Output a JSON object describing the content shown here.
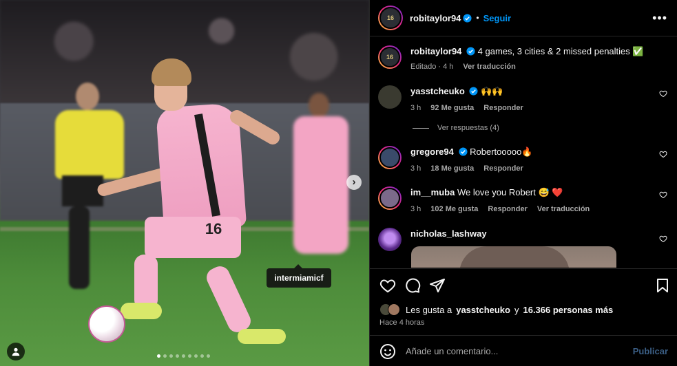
{
  "post": {
    "author": "robitaylor94",
    "follow_label": "Seguir",
    "separator": "•",
    "avatar_text": "16",
    "media": {
      "tag_label": "intermiamicf",
      "jersey_number": "16",
      "carousel_count": 9,
      "carousel_active": 1
    }
  },
  "caption": {
    "username": "robitaylor94",
    "text": "4 games, 3 cities & 2 missed penalties ✅",
    "meta_edited": "Editado · 4 h",
    "meta_translate": "Ver traducción"
  },
  "comments": [
    {
      "username": "yasstcheuko",
      "verified": true,
      "text": "🙌🙌",
      "time": "3 h",
      "likes": "92 Me gusta",
      "reply": "Responder",
      "view_replies": "Ver respuestas (4)"
    },
    {
      "username": "gregore94",
      "verified": true,
      "text": "Robertooooo🔥",
      "time": "3 h",
      "likes": "18 Me gusta",
      "reply": "Responder"
    },
    {
      "username": "im__muba",
      "verified": false,
      "text": "We love you Robert 😅 ❤️",
      "time": "3 h",
      "likes": "102 Me gusta",
      "reply": "Responder",
      "translate": "Ver traducción"
    },
    {
      "username": "nicholas_lashway",
      "verified": false,
      "text": ""
    }
  ],
  "engagement": {
    "likes_prefix": "Les gusta a",
    "likes_user": "yasstcheuko",
    "likes_middle": "y",
    "likes_count": "16.366 personas más",
    "time_ago": "Hace 4 horas"
  },
  "composer": {
    "placeholder": "Añade un comentario...",
    "publish_label": "Publicar"
  },
  "icons": {
    "more": "more-horizontal-icon",
    "like": "heart-outline-icon",
    "comment": "comment-bubble-icon",
    "share": "paper-plane-icon",
    "save": "bookmark-icon",
    "emoji": "smiley-icon",
    "verified": "verified-badge-icon",
    "next": "chevron-right-icon",
    "user_tags": "person-icon"
  },
  "colors": {
    "accent": "#0095f6",
    "background": "#000000",
    "muted": "#a8a8a8",
    "publish_disabled": "#3b5f86",
    "jersey_pink": "#f6b4cf"
  }
}
